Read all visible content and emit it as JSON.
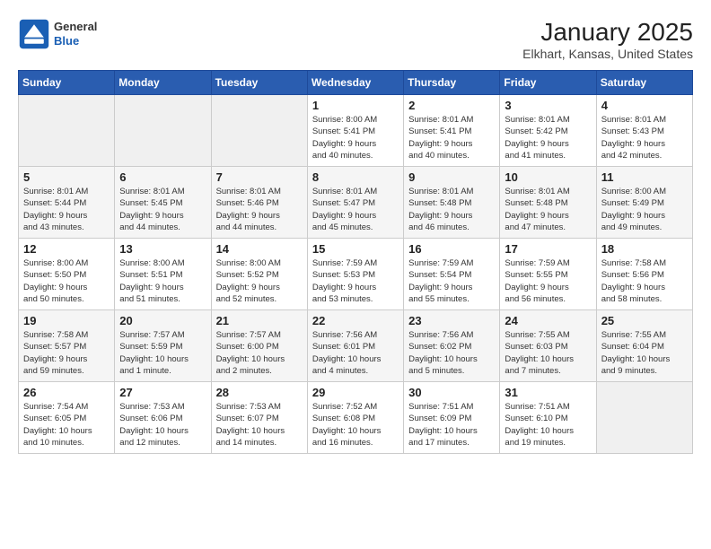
{
  "logo": {
    "general": "General",
    "blue": "Blue"
  },
  "title": "January 2025",
  "subtitle": "Elkhart, Kansas, United States",
  "headers": [
    "Sunday",
    "Monday",
    "Tuesday",
    "Wednesday",
    "Thursday",
    "Friday",
    "Saturday"
  ],
  "weeks": [
    [
      {
        "day": "",
        "info": ""
      },
      {
        "day": "",
        "info": ""
      },
      {
        "day": "",
        "info": ""
      },
      {
        "day": "1",
        "info": "Sunrise: 8:00 AM\nSunset: 5:41 PM\nDaylight: 9 hours\nand 40 minutes."
      },
      {
        "day": "2",
        "info": "Sunrise: 8:01 AM\nSunset: 5:41 PM\nDaylight: 9 hours\nand 40 minutes."
      },
      {
        "day": "3",
        "info": "Sunrise: 8:01 AM\nSunset: 5:42 PM\nDaylight: 9 hours\nand 41 minutes."
      },
      {
        "day": "4",
        "info": "Sunrise: 8:01 AM\nSunset: 5:43 PM\nDaylight: 9 hours\nand 42 minutes."
      }
    ],
    [
      {
        "day": "5",
        "info": "Sunrise: 8:01 AM\nSunset: 5:44 PM\nDaylight: 9 hours\nand 43 minutes."
      },
      {
        "day": "6",
        "info": "Sunrise: 8:01 AM\nSunset: 5:45 PM\nDaylight: 9 hours\nand 44 minutes."
      },
      {
        "day": "7",
        "info": "Sunrise: 8:01 AM\nSunset: 5:46 PM\nDaylight: 9 hours\nand 44 minutes."
      },
      {
        "day": "8",
        "info": "Sunrise: 8:01 AM\nSunset: 5:47 PM\nDaylight: 9 hours\nand 45 minutes."
      },
      {
        "day": "9",
        "info": "Sunrise: 8:01 AM\nSunset: 5:48 PM\nDaylight: 9 hours\nand 46 minutes."
      },
      {
        "day": "10",
        "info": "Sunrise: 8:01 AM\nSunset: 5:48 PM\nDaylight: 9 hours\nand 47 minutes."
      },
      {
        "day": "11",
        "info": "Sunrise: 8:00 AM\nSunset: 5:49 PM\nDaylight: 9 hours\nand 49 minutes."
      }
    ],
    [
      {
        "day": "12",
        "info": "Sunrise: 8:00 AM\nSunset: 5:50 PM\nDaylight: 9 hours\nand 50 minutes."
      },
      {
        "day": "13",
        "info": "Sunrise: 8:00 AM\nSunset: 5:51 PM\nDaylight: 9 hours\nand 51 minutes."
      },
      {
        "day": "14",
        "info": "Sunrise: 8:00 AM\nSunset: 5:52 PM\nDaylight: 9 hours\nand 52 minutes."
      },
      {
        "day": "15",
        "info": "Sunrise: 7:59 AM\nSunset: 5:53 PM\nDaylight: 9 hours\nand 53 minutes."
      },
      {
        "day": "16",
        "info": "Sunrise: 7:59 AM\nSunset: 5:54 PM\nDaylight: 9 hours\nand 55 minutes."
      },
      {
        "day": "17",
        "info": "Sunrise: 7:59 AM\nSunset: 5:55 PM\nDaylight: 9 hours\nand 56 minutes."
      },
      {
        "day": "18",
        "info": "Sunrise: 7:58 AM\nSunset: 5:56 PM\nDaylight: 9 hours\nand 58 minutes."
      }
    ],
    [
      {
        "day": "19",
        "info": "Sunrise: 7:58 AM\nSunset: 5:57 PM\nDaylight: 9 hours\nand 59 minutes."
      },
      {
        "day": "20",
        "info": "Sunrise: 7:57 AM\nSunset: 5:59 PM\nDaylight: 10 hours\nand 1 minute."
      },
      {
        "day": "21",
        "info": "Sunrise: 7:57 AM\nSunset: 6:00 PM\nDaylight: 10 hours\nand 2 minutes."
      },
      {
        "day": "22",
        "info": "Sunrise: 7:56 AM\nSunset: 6:01 PM\nDaylight: 10 hours\nand 4 minutes."
      },
      {
        "day": "23",
        "info": "Sunrise: 7:56 AM\nSunset: 6:02 PM\nDaylight: 10 hours\nand 5 minutes."
      },
      {
        "day": "24",
        "info": "Sunrise: 7:55 AM\nSunset: 6:03 PM\nDaylight: 10 hours\nand 7 minutes."
      },
      {
        "day": "25",
        "info": "Sunrise: 7:55 AM\nSunset: 6:04 PM\nDaylight: 10 hours\nand 9 minutes."
      }
    ],
    [
      {
        "day": "26",
        "info": "Sunrise: 7:54 AM\nSunset: 6:05 PM\nDaylight: 10 hours\nand 10 minutes."
      },
      {
        "day": "27",
        "info": "Sunrise: 7:53 AM\nSunset: 6:06 PM\nDaylight: 10 hours\nand 12 minutes."
      },
      {
        "day": "28",
        "info": "Sunrise: 7:53 AM\nSunset: 6:07 PM\nDaylight: 10 hours\nand 14 minutes."
      },
      {
        "day": "29",
        "info": "Sunrise: 7:52 AM\nSunset: 6:08 PM\nDaylight: 10 hours\nand 16 minutes."
      },
      {
        "day": "30",
        "info": "Sunrise: 7:51 AM\nSunset: 6:09 PM\nDaylight: 10 hours\nand 17 minutes."
      },
      {
        "day": "31",
        "info": "Sunrise: 7:51 AM\nSunset: 6:10 PM\nDaylight: 10 hours\nand 19 minutes."
      },
      {
        "day": "",
        "info": ""
      }
    ]
  ]
}
